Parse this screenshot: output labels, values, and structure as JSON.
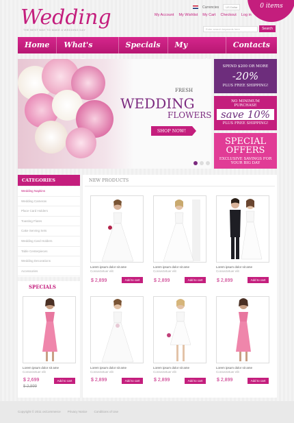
{
  "logo": {
    "text": "Wedding",
    "tagline": "THE BEST WAY TO MAKE A WEDDING DAY"
  },
  "header": {
    "currency_label": "Currencies",
    "currency_select": "US Dollar",
    "links": [
      "My Account",
      "My Wishlist",
      "My Cart",
      "Checkout",
      "Log in"
    ],
    "cart": "0 items",
    "search_placeholder": "Enter search keywords here",
    "search_button": "Search"
  },
  "nav": {
    "items": [
      "Home",
      "What's new?",
      "Specials",
      "My account",
      "Contacts"
    ]
  },
  "banner": {
    "fresh": "FRESH",
    "wedding": "WEDDING",
    "flowers": "FLOWERS",
    "cta": "SHOP NOW!"
  },
  "promos": [
    {
      "line1": "SPEND $200 OR MORE",
      "big": "-20%",
      "line2": "PLUS FREE SHIPPING!"
    },
    {
      "line1": "NO MINIMUM",
      "line1b": "PURCHASE",
      "big": "save 10%",
      "line2": "PLUS FREE SHIPPING!"
    },
    {
      "line1": "SPECIAL",
      "big": "OFFERS",
      "line2": "EXCLUSIVE SAVINGS FOR",
      "line3": "YOUR BIG DAY"
    }
  ],
  "categories": {
    "title": "CATEGORIES",
    "items": [
      "Wedding Napkins",
      "Wedding Cameras",
      "Place Card Holders",
      "Toasting Flutes",
      "Cake Serving Sets",
      "Wedding Card Holders",
      "Table Centerpieces",
      "Wedding Decorations",
      "Accessories"
    ]
  },
  "specials": {
    "title": "SPECIALS",
    "product": {
      "name": "Lorem ipsum dolor sit ame",
      "sub": "Consectetuer elit",
      "price": "$ 2,699",
      "old_price": "$ 2,899",
      "button": "Add to cart"
    }
  },
  "new_products": {
    "title": "NEW PRODUCTS",
    "items": [
      {
        "name": "Lorem ipsum dolor sit ame",
        "sub": "Consectetuer elit",
        "price": "$ 2,899",
        "button": "Add to cart"
      },
      {
        "name": "Lorem ipsum dolor sit ame",
        "sub": "Consectetuer elit",
        "price": "$ 2,899",
        "button": "Add to cart"
      },
      {
        "name": "Lorem ipsum dolor sit ame",
        "sub": "Consectetuer elit",
        "price": "$ 2,899",
        "button": "Add to cart"
      },
      {
        "name": "Lorem ipsum dolor sit ame",
        "sub": "Consectetuer elit",
        "price": "$ 2,899",
        "button": "Add to cart"
      },
      {
        "name": "Lorem ipsum dolor sit ame",
        "sub": "Consectetuer elit",
        "price": "$ 2,899",
        "button": "Add to cart"
      },
      {
        "name": "Lorem ipsum dolor sit ame",
        "sub": "Consectetuer elit",
        "price": "$ 2,899",
        "button": "Add to cart"
      }
    ]
  },
  "footer": {
    "copyright": "Copyright © 2011 osCommerce",
    "links": [
      "Privacy Notice",
      "Conditions of Use"
    ]
  },
  "colors": {
    "accent": "#c41e7d",
    "purple": "#6d2d7c"
  }
}
